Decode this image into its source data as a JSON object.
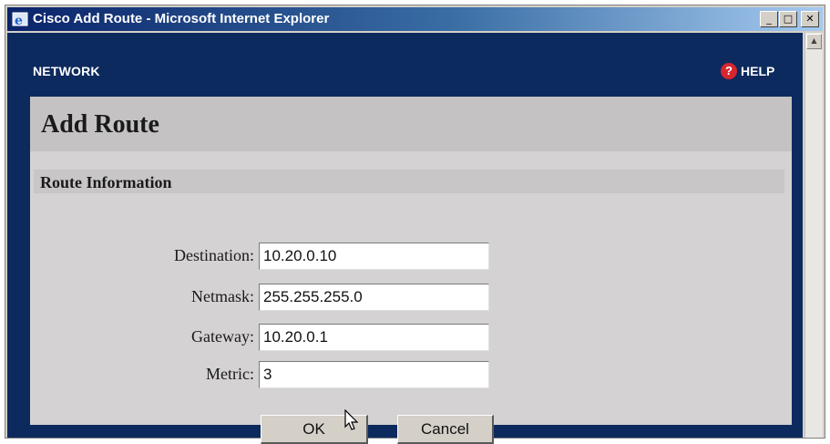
{
  "window": {
    "title": "Cisco Add Route - Microsoft Internet Explorer",
    "controls": {
      "minimize": "_",
      "maximize": "□",
      "close": "✕"
    }
  },
  "header": {
    "section": "NETWORK",
    "help_label": "HELP",
    "help_icon": "question-icon"
  },
  "page": {
    "title": "Add Route",
    "section_title": "Route Information"
  },
  "form": {
    "destination": {
      "label": "Destination:",
      "value": "10.20.0.10"
    },
    "netmask": {
      "label": "Netmask:",
      "value": "255.255.255.0"
    },
    "gateway": {
      "label": "Gateway:",
      "value": "10.20.0.1"
    },
    "metric": {
      "label": "Metric:",
      "value": "3"
    }
  },
  "buttons": {
    "ok": "OK",
    "cancel": "Cancel"
  },
  "colors": {
    "frame": "#0d2a5e",
    "panel": "#d4d2d2",
    "help_icon": "#d8262e"
  }
}
